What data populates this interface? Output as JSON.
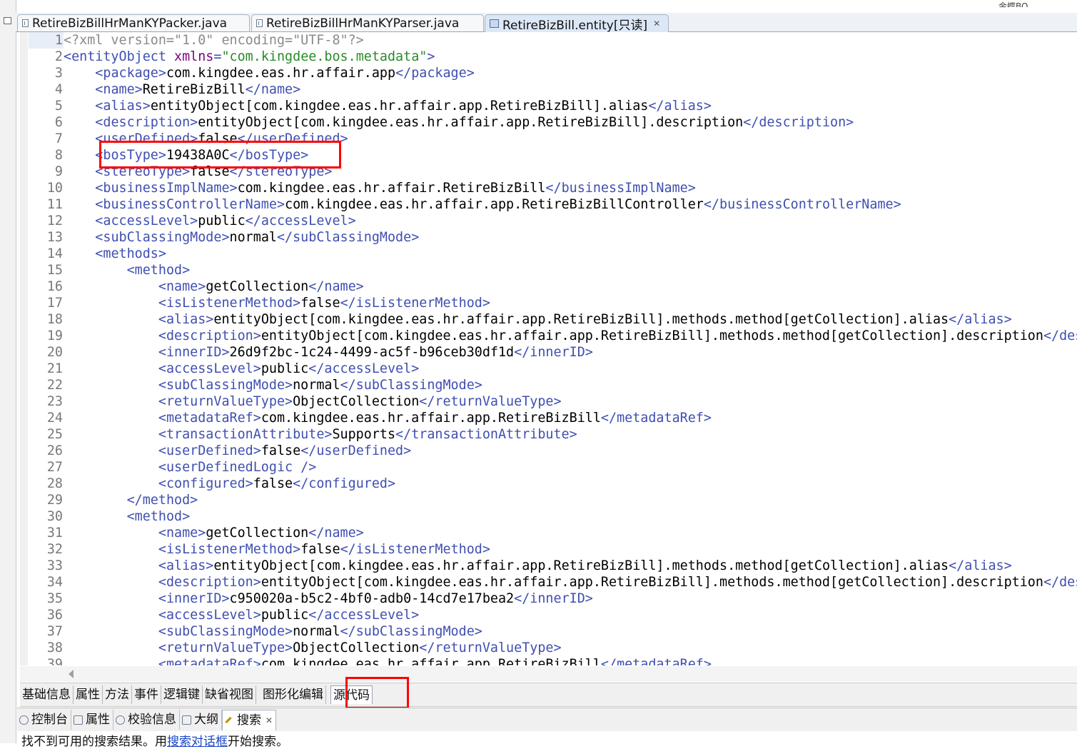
{
  "top_right_text": "金蝶BO",
  "tabs": [
    {
      "label": "RetireBizBillHrManKYPacker.java",
      "icon": "java-file-icon",
      "active": false
    },
    {
      "label": "RetireBizBillHrManKYParser.java",
      "icon": "java-file-icon",
      "active": false
    },
    {
      "label": "RetireBizBill.entity[只读]",
      "icon": "entity-file-icon",
      "active": true,
      "close": "✕"
    }
  ],
  "code_lines": [
    {
      "n": "1",
      "indent": 0,
      "segs": [
        [
          "pi",
          "<?xml version=\"1.0\" encoding=\"UTF-8\"?>"
        ]
      ]
    },
    {
      "n": "2",
      "indent": 0,
      "segs": [
        [
          "tag",
          "<entityObject "
        ],
        [
          "attrn",
          "xmlns"
        ],
        [
          "tag",
          "="
        ],
        [
          "attrv",
          "\"com.kingdee.bos.metadata\""
        ],
        [
          "tag",
          ">"
        ]
      ]
    },
    {
      "n": "3",
      "indent": 1,
      "segs": [
        [
          "tag",
          "<package>"
        ],
        [
          "body",
          "com.kingdee.eas.hr.affair.app"
        ],
        [
          "tag",
          "</package>"
        ]
      ]
    },
    {
      "n": "4",
      "indent": 1,
      "segs": [
        [
          "tag",
          "<name>"
        ],
        [
          "body",
          "RetireBizBill"
        ],
        [
          "tag",
          "</name>"
        ]
      ]
    },
    {
      "n": "5",
      "indent": 1,
      "segs": [
        [
          "tag",
          "<alias>"
        ],
        [
          "body",
          "entityObject[com.kingdee.eas.hr.affair.app.RetireBizBill].alias"
        ],
        [
          "tag",
          "</alias>"
        ]
      ]
    },
    {
      "n": "6",
      "indent": 1,
      "segs": [
        [
          "tag",
          "<description>"
        ],
        [
          "body",
          "entityObject[com.kingdee.eas.hr.affair.app.RetireBizBill].description"
        ],
        [
          "tag",
          "</description>"
        ]
      ]
    },
    {
      "n": "7",
      "indent": 1,
      "segs": [
        [
          "tag",
          "<userDefined>"
        ],
        [
          "body",
          "false"
        ],
        [
          "tag",
          "</userDefined>"
        ]
      ]
    },
    {
      "n": "8",
      "indent": 1,
      "segs": [
        [
          "tag",
          "<bosType>"
        ],
        [
          "body",
          "19438A0C"
        ],
        [
          "tag",
          "</bosType>"
        ]
      ]
    },
    {
      "n": "9",
      "indent": 1,
      "segs": [
        [
          "tag",
          "<stereoType>"
        ],
        [
          "body",
          "false"
        ],
        [
          "tag",
          "</stereoType>"
        ]
      ]
    },
    {
      "n": "10",
      "indent": 1,
      "segs": [
        [
          "tag",
          "<businessImplName>"
        ],
        [
          "body",
          "com.kingdee.eas.hr.affair.RetireBizBill"
        ],
        [
          "tag",
          "</businessImplName>"
        ]
      ]
    },
    {
      "n": "11",
      "indent": 1,
      "segs": [
        [
          "tag",
          "<businessControllerName>"
        ],
        [
          "body",
          "com.kingdee.eas.hr.affair.app.RetireBizBillController"
        ],
        [
          "tag",
          "</businessControllerName>"
        ]
      ]
    },
    {
      "n": "12",
      "indent": 1,
      "segs": [
        [
          "tag",
          "<accessLevel>"
        ],
        [
          "body",
          "public"
        ],
        [
          "tag",
          "</accessLevel>"
        ]
      ]
    },
    {
      "n": "13",
      "indent": 1,
      "segs": [
        [
          "tag",
          "<subClassingMode>"
        ],
        [
          "body",
          "normal"
        ],
        [
          "tag",
          "</subClassingMode>"
        ]
      ]
    },
    {
      "n": "14",
      "indent": 1,
      "segs": [
        [
          "tag",
          "<methods>"
        ]
      ]
    },
    {
      "n": "15",
      "indent": 2,
      "segs": [
        [
          "tag",
          "<method>"
        ]
      ]
    },
    {
      "n": "16",
      "indent": 3,
      "segs": [
        [
          "tag",
          "<name>"
        ],
        [
          "body",
          "getCollection"
        ],
        [
          "tag",
          "</name>"
        ]
      ]
    },
    {
      "n": "17",
      "indent": 3,
      "segs": [
        [
          "tag",
          "<isListenerMethod>"
        ],
        [
          "body",
          "false"
        ],
        [
          "tag",
          "</isListenerMethod>"
        ]
      ]
    },
    {
      "n": "18",
      "indent": 3,
      "segs": [
        [
          "tag",
          "<alias>"
        ],
        [
          "body",
          "entityObject[com.kingdee.eas.hr.affair.app.RetireBizBill].methods.method[getCollection].alias"
        ],
        [
          "tag",
          "</alias>"
        ]
      ]
    },
    {
      "n": "19",
      "indent": 3,
      "segs": [
        [
          "tag",
          "<description>"
        ],
        [
          "body",
          "entityObject[com.kingdee.eas.hr.affair.app.RetireBizBill].methods.method[getCollection].description"
        ],
        [
          "tag",
          "</description>"
        ]
      ]
    },
    {
      "n": "20",
      "indent": 3,
      "segs": [
        [
          "tag",
          "<innerID>"
        ],
        [
          "body",
          "26d9f2bc-1c24-4499-ac5f-b96ceb30df1d"
        ],
        [
          "tag",
          "</innerID>"
        ]
      ]
    },
    {
      "n": "21",
      "indent": 3,
      "segs": [
        [
          "tag",
          "<accessLevel>"
        ],
        [
          "body",
          "public"
        ],
        [
          "tag",
          "</accessLevel>"
        ]
      ]
    },
    {
      "n": "22",
      "indent": 3,
      "segs": [
        [
          "tag",
          "<subClassingMode>"
        ],
        [
          "body",
          "normal"
        ],
        [
          "tag",
          "</subClassingMode>"
        ]
      ]
    },
    {
      "n": "23",
      "indent": 3,
      "segs": [
        [
          "tag",
          "<returnValueType>"
        ],
        [
          "body",
          "ObjectCollection"
        ],
        [
          "tag",
          "</returnValueType>"
        ]
      ]
    },
    {
      "n": "24",
      "indent": 3,
      "segs": [
        [
          "tag",
          "<metadataRef>"
        ],
        [
          "body",
          "com.kingdee.eas.hr.affair.app.RetireBizBill"
        ],
        [
          "tag",
          "</metadataRef>"
        ]
      ]
    },
    {
      "n": "25",
      "indent": 3,
      "segs": [
        [
          "tag",
          "<transactionAttribute>"
        ],
        [
          "body",
          "Supports"
        ],
        [
          "tag",
          "</transactionAttribute>"
        ]
      ]
    },
    {
      "n": "26",
      "indent": 3,
      "segs": [
        [
          "tag",
          "<userDefined>"
        ],
        [
          "body",
          "false"
        ],
        [
          "tag",
          "</userDefined>"
        ]
      ]
    },
    {
      "n": "27",
      "indent": 3,
      "segs": [
        [
          "tag",
          "<userDefinedLogic />"
        ]
      ]
    },
    {
      "n": "28",
      "indent": 3,
      "segs": [
        [
          "tag",
          "<configured>"
        ],
        [
          "body",
          "false"
        ],
        [
          "tag",
          "</configured>"
        ]
      ]
    },
    {
      "n": "29",
      "indent": 2,
      "segs": [
        [
          "tag",
          "</method>"
        ]
      ]
    },
    {
      "n": "30",
      "indent": 2,
      "segs": [
        [
          "tag",
          "<method>"
        ]
      ]
    },
    {
      "n": "31",
      "indent": 3,
      "segs": [
        [
          "tag",
          "<name>"
        ],
        [
          "body",
          "getCollection"
        ],
        [
          "tag",
          "</name>"
        ]
      ]
    },
    {
      "n": "32",
      "indent": 3,
      "segs": [
        [
          "tag",
          "<isListenerMethod>"
        ],
        [
          "body",
          "false"
        ],
        [
          "tag",
          "</isListenerMethod>"
        ]
      ]
    },
    {
      "n": "33",
      "indent": 3,
      "segs": [
        [
          "tag",
          "<alias>"
        ],
        [
          "body",
          "entityObject[com.kingdee.eas.hr.affair.app.RetireBizBill].methods.method[getCollection].alias"
        ],
        [
          "tag",
          "</alias>"
        ]
      ]
    },
    {
      "n": "34",
      "indent": 3,
      "segs": [
        [
          "tag",
          "<description>"
        ],
        [
          "body",
          "entityObject[com.kingdee.eas.hr.affair.app.RetireBizBill].methods.method[getCollection].description"
        ],
        [
          "tag",
          "</description>"
        ]
      ]
    },
    {
      "n": "35",
      "indent": 3,
      "segs": [
        [
          "tag",
          "<innerID>"
        ],
        [
          "body",
          "c950020a-b5c2-4bf0-adb0-14cd7e17bea2"
        ],
        [
          "tag",
          "</innerID>"
        ]
      ]
    },
    {
      "n": "36",
      "indent": 3,
      "segs": [
        [
          "tag",
          "<accessLevel>"
        ],
        [
          "body",
          "public"
        ],
        [
          "tag",
          "</accessLevel>"
        ]
      ]
    },
    {
      "n": "37",
      "indent": 3,
      "segs": [
        [
          "tag",
          "<subClassingMode>"
        ],
        [
          "body",
          "normal"
        ],
        [
          "tag",
          "</subClassingMode>"
        ]
      ]
    },
    {
      "n": "38",
      "indent": 3,
      "segs": [
        [
          "tag",
          "<returnValueType>"
        ],
        [
          "body",
          "ObjectCollection"
        ],
        [
          "tag",
          "</returnValueType>"
        ]
      ]
    },
    {
      "n": "39",
      "indent": 3,
      "segs": [
        [
          "tag",
          "<metadataRef>"
        ],
        [
          "body",
          "com.kingdee.eas.hr.affair.app.RetireBizBill"
        ],
        [
          "tag",
          "</metadataRef>"
        ]
      ]
    }
  ],
  "bottom_tabs": [
    {
      "label": "基础信息",
      "active": false
    },
    {
      "label": "属性",
      "active": false
    },
    {
      "label": "方法",
      "active": false
    },
    {
      "label": "事件",
      "active": false
    },
    {
      "label": "逻辑键",
      "active": false
    },
    {
      "label": "缺省视图",
      "active": false
    },
    {
      "label": "图形化编辑",
      "active": false
    },
    {
      "label": "源代码",
      "active": true
    }
  ],
  "view_tabs": [
    {
      "label": "控制台",
      "icon": "console-icon",
      "active": false
    },
    {
      "label": "属性",
      "icon": "properties-icon",
      "active": false
    },
    {
      "label": "校验信息",
      "icon": "validation-icon",
      "active": false
    },
    {
      "label": "大纲",
      "icon": "outline-icon",
      "active": false
    },
    {
      "label": "搜索",
      "icon": "search-icon",
      "active": true,
      "close": "✕"
    }
  ],
  "status": {
    "prefix": "找不到可用的搜索结果。用",
    "link": "搜索对话框",
    "suffix": "开始搜索。"
  },
  "colors": {
    "tag": "#3f4fb0",
    "highlight": "#ff0000"
  }
}
